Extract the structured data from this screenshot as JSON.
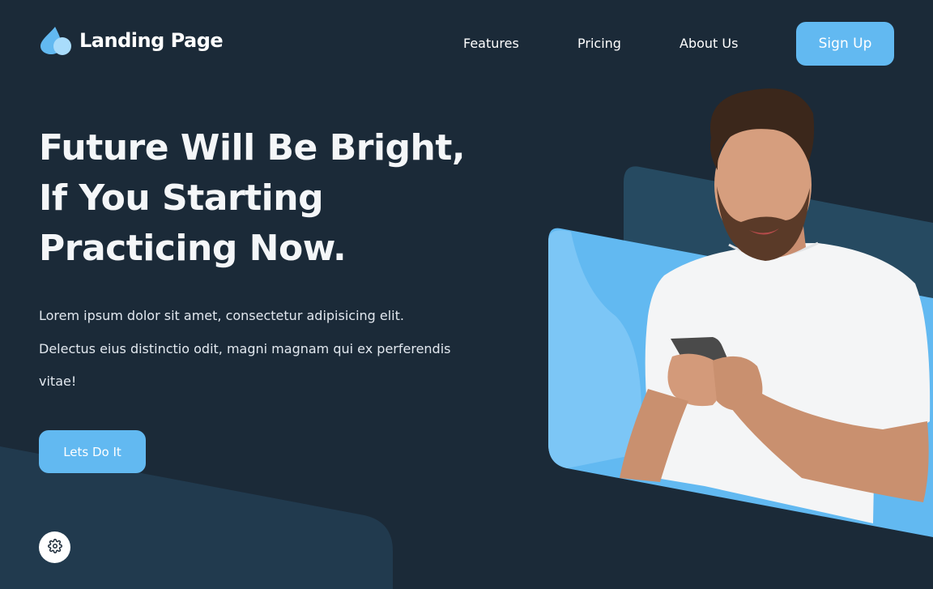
{
  "brand": {
    "name": "Landing Page",
    "logo_icon": "droplets-icon",
    "accent": "#62b9f1"
  },
  "nav": {
    "items": [
      {
        "label": "Features"
      },
      {
        "label": "Pricing"
      },
      {
        "label": "About Us"
      }
    ],
    "signup_label": "Sign Up"
  },
  "hero": {
    "headline_lines": [
      "Future Will Be Bright,",
      "If You Starting",
      "Practicing Now."
    ],
    "description": "Lorem ipsum dolor sit amet, consectetur adipisicing elit. Delectus eius distinctio odit, magni magnam qui ex perferendis vitae!",
    "cta_label": "Lets Do It",
    "image": "man-with-smartphone"
  },
  "settings": {
    "icon": "gear-icon"
  },
  "colors": {
    "background": "#1b2a38",
    "panel": "#263f52",
    "accent": "#62b9f1"
  }
}
